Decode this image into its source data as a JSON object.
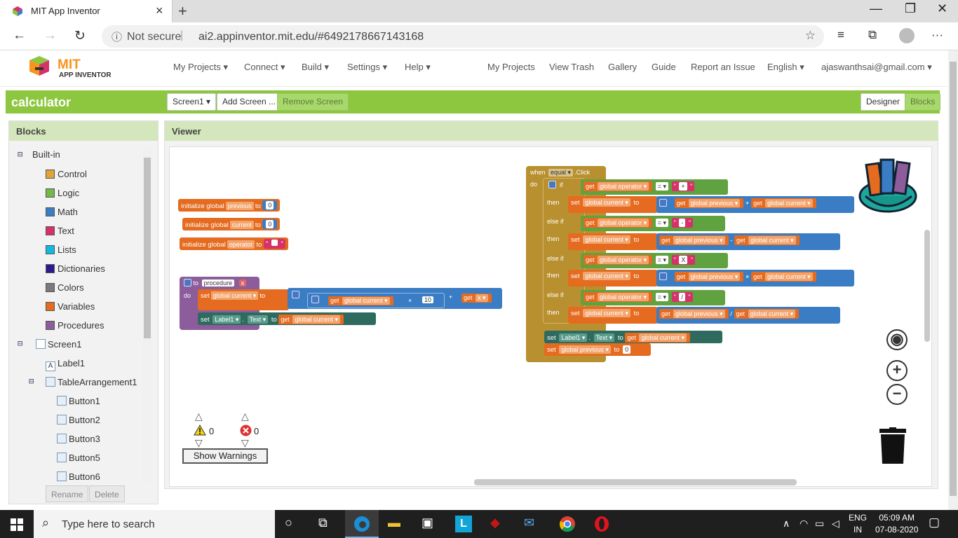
{
  "browser": {
    "tab_title": "MIT App Inventor",
    "not_secure": "Not secure",
    "url": "ai2.appinventor.mit.edu/#6492178667143168"
  },
  "header": {
    "logo_mit": "MIT",
    "logo_sub": "APP INVENTOR",
    "menus": [
      "My Projects ▾",
      "Connect ▾",
      "Build ▾",
      "Settings ▾",
      "Help ▾"
    ],
    "links": [
      "My Projects",
      "View Trash",
      "Gallery",
      "Guide",
      "Report an Issue",
      "English ▾",
      "ajaswanthsai@gmail.com ▾"
    ]
  },
  "toolbar": {
    "project": "calculator",
    "screen_select": "Screen1 ▾",
    "add_screen": "Add Screen ...",
    "remove_screen": "Remove Screen",
    "designer": "Designer",
    "blocks": "Blocks"
  },
  "blocks_panel": {
    "title": "Blocks",
    "builtin": "Built-in",
    "categories": [
      {
        "label": "Control",
        "color": "#e2a33b"
      },
      {
        "label": "Logic",
        "color": "#74b848"
      },
      {
        "label": "Math",
        "color": "#3a7dc4"
      },
      {
        "label": "Text",
        "color": "#d5326a"
      },
      {
        "label": "Lists",
        "color": "#14b8de"
      },
      {
        "label": "Dictionaries",
        "color": "#2e1a8c"
      },
      {
        "label": "Colors",
        "color": "#7a7a7a"
      },
      {
        "label": "Variables",
        "color": "#e46b1f"
      },
      {
        "label": "Procedures",
        "color": "#8c5c9b"
      }
    ],
    "screen": "Screen1",
    "components": [
      "Label1",
      "TableArrangement1",
      "Button1",
      "Button2",
      "Button3",
      "Button5",
      "Button6"
    ],
    "rename": "Rename",
    "delete": "Delete"
  },
  "viewer": {
    "title": "Viewer",
    "warnings_count": "0",
    "errors_count": "0",
    "show_warnings": "Show Warnings",
    "blocks": {
      "init_prefix": "initialize global",
      "to": "to",
      "var_previous": "previous",
      "var_current": "current",
      "var_operator": "operator",
      "zero": "0",
      "proc_to": "to",
      "proc_name": "procedure",
      "x": "x",
      "do": "do",
      "set": "set",
      "get": "get",
      "global_current": "global current ▾",
      "global_previous": "global previous ▾",
      "global_operator": "global operator ▾",
      "label1": "Label1 ▾",
      "text_prop": "Text ▾",
      "ten": "10",
      "get_x": "x ▾",
      "when": "when",
      "equal": "equal ▾",
      "click": ".Click",
      "if": "if",
      "then": "then",
      "else_if": "else if",
      "eq": "= ▾",
      "plus": "+",
      "minus": "-",
      "times": "×",
      "div": "/",
      "op_plus": "+",
      "op_minus": "-",
      "op_x": "X",
      "op_div": "/"
    }
  },
  "taskbar": {
    "search": "Type here to search",
    "lang1": "ENG",
    "lang2": "IN",
    "time": "05:09 AM",
    "date": "07-08-2020"
  }
}
